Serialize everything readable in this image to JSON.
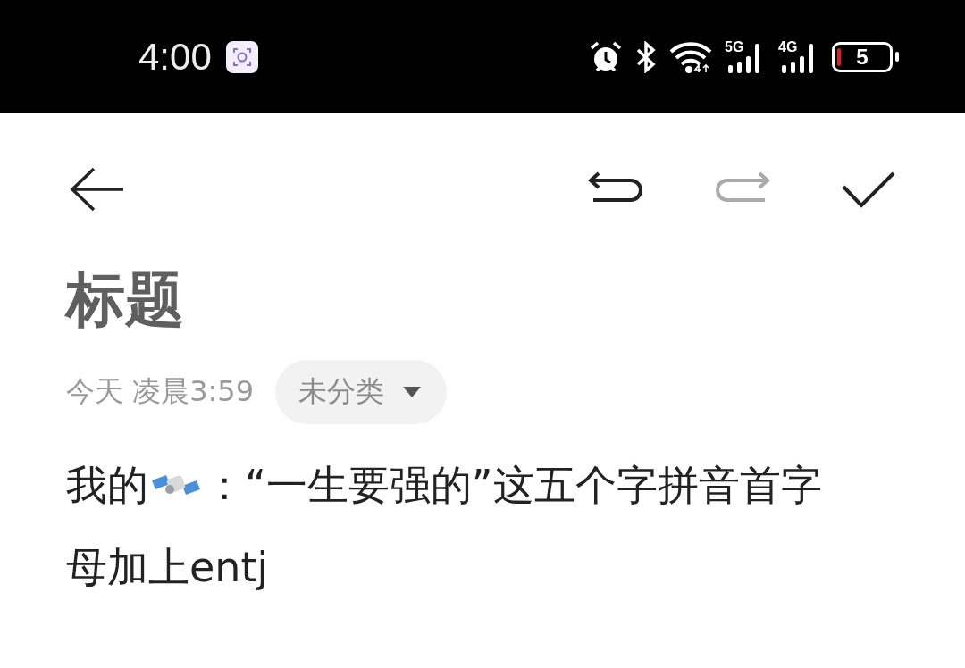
{
  "status_bar": {
    "time": "4:00",
    "network_1": "5G",
    "network_2": "4G",
    "battery": "5"
  },
  "toolbar": {
    "actions": [
      {
        "kind": "undo",
        "disabled": false
      },
      {
        "kind": "redo",
        "disabled": true
      },
      {
        "kind": "done",
        "disabled": false
      }
    ]
  },
  "note": {
    "title": "标题",
    "date": "今天 凌晨3:59",
    "category": "未分类",
    "body_start": "我的",
    "body_rest": "：“一生要强的”这五个字拼音首字",
    "body_line_2": "母加上entj"
  }
}
